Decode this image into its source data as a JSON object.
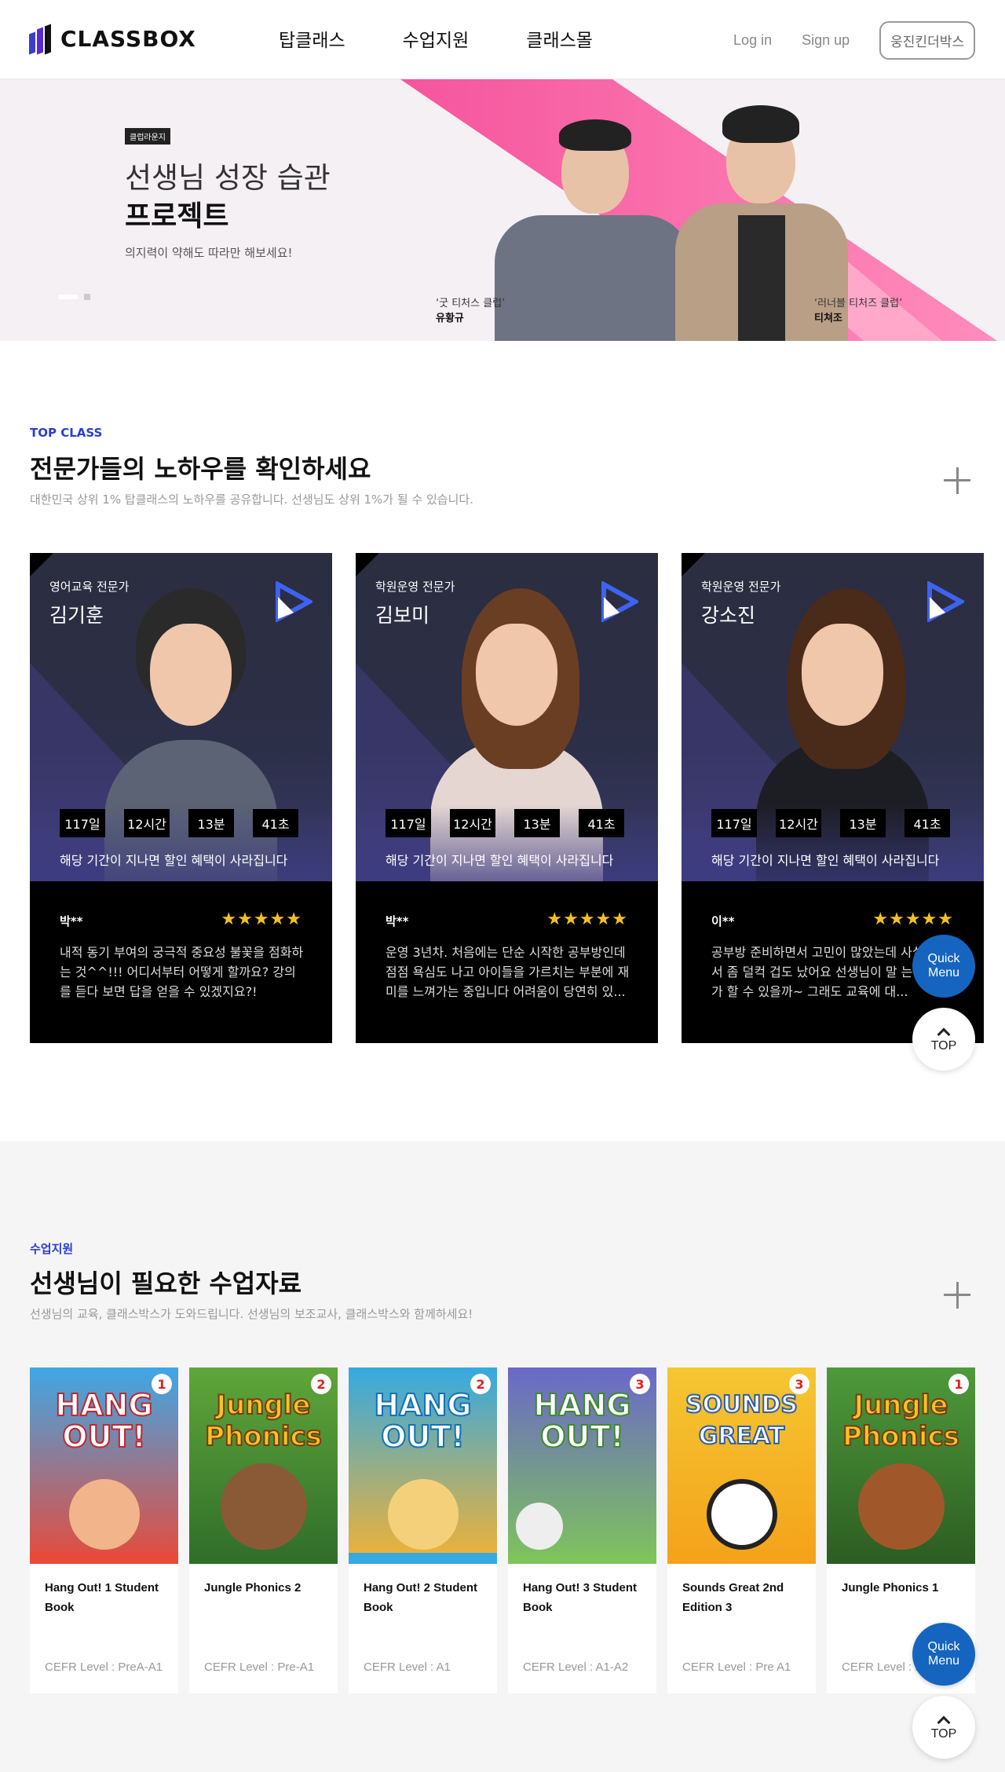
{
  "header": {
    "logo_text": "CLASSBOX",
    "nav": [
      "탑클래스",
      "수업지원",
      "클래스몰"
    ],
    "login": "Log in",
    "signup": "Sign up",
    "kinder_button": "웅진킨더박스"
  },
  "hero": {
    "badge": "클럽라운지",
    "title_line1": "선생님 성장 습관",
    "title_line2": "프로젝트",
    "subtitle": "의지력이 약해도 따라만 해보세요!",
    "person1": {
      "caption": "‘굿 티처스 클럽’",
      "name": "유황규"
    },
    "person2": {
      "caption": "‘러너블 티처즈 클럽’",
      "name": "티쳐조"
    },
    "colors": {
      "stripe": "#f5559d",
      "bg": "#f5f0f4"
    }
  },
  "top_class": {
    "label": "TOP CLASS",
    "title": "전문가들의 노하우를 확인하세요",
    "desc": "대한민국 상위 1% 탑클래스의 노하우를 공유합니다. 선생님도 상위 1%가 될 수 있습니다.",
    "cards": [
      {
        "role": "영어교육 전문가",
        "name": "김기훈",
        "timer": [
          "117일",
          "12시간",
          "13분",
          "41초"
        ],
        "note": "해당 기간이 지나면 할인 혜택이 사라집니다",
        "reviewer": "박**",
        "stars": "★★★★★",
        "review": "내적 동기 부여의 궁극적 중요성 불꽃을 점화하는 것^^!!! 어디서부터 어떻게 할까요? 강의를 듣다 보면 답을 얻을 수 있겠지요?!"
      },
      {
        "role": "학원운영 전문가",
        "name": "김보미",
        "timer": [
          "117일",
          "12시간",
          "13분",
          "41초"
        ],
        "note": "해당 기간이 지나면 할인 혜택이 사라집니다",
        "reviewer": "박**",
        "stars": "★★★★★",
        "review": "운영 3년차. 처음에는 단순 시작한 공부방인데 점점 욕심도 나고 아이들을 가르치는 부분에 재미를 느껴가는 중입니다 어려움이 당연히 있..."
      },
      {
        "role": "학원운영 전문가",
        "name": "강소진",
        "timer": [
          "117일",
          "12시간",
          "13분",
          "41초"
        ],
        "note": "해당 기간이 지나면 할인 혜택이 사라집니다",
        "reviewer": "이**",
        "stars": "★★★★★",
        "review": "공부방 준비하면서 고민이 많았는데 사실 보면서 좀 덜컥 겁도 났어요 선생님이 말 는 것을 내가 할 수 있을까~ 그래도 교육에 대..."
      }
    ]
  },
  "materials": {
    "label": "수업지원",
    "title": "선생님이 필요한 수업자료",
    "desc": "선생님의 교육, 클래스박스가 도와드립니다. 선생님의 보조교사, 클래스박스와 함께하세요!",
    "books": [
      {
        "cover_text": "HANG OUT!",
        "num": "1",
        "title": "Hang Out! 1 Student Book",
        "level": "CEFR Level : PreA-A1",
        "cover_color": "#e84a3a"
      },
      {
        "cover_text": "Jungle Phonics",
        "num": "2",
        "title": "Jungle Phonics 2",
        "level": "CEFR Level : Pre-A1",
        "cover_color": "#5fa63a"
      },
      {
        "cover_text": "HANG OUT!",
        "num": "2",
        "title": "Hang Out! 2 Student Book",
        "level": "CEFR Level : A1",
        "cover_color": "#35a9e0"
      },
      {
        "cover_text": "HANG OUT!",
        "num": "3",
        "title": "Hang Out! 3 Student Book",
        "level": "CEFR Level : A1-A2",
        "cover_color": "#7fc45a"
      },
      {
        "cover_text": "SOUNDS GREAT",
        "num": "3",
        "title": "Sounds Great 2nd Edition 3",
        "level": "CEFR Level : Pre A1",
        "cover_color": "#f5c632"
      },
      {
        "cover_text": "Jungle Phonics",
        "num": "1",
        "title": "Jungle Phonics 1",
        "level": "CEFR Level : Pre-A1",
        "cover_color": "#4e9a3a"
      }
    ]
  },
  "floating": {
    "quick_menu": "Quick Menu",
    "top": "TOP"
  }
}
